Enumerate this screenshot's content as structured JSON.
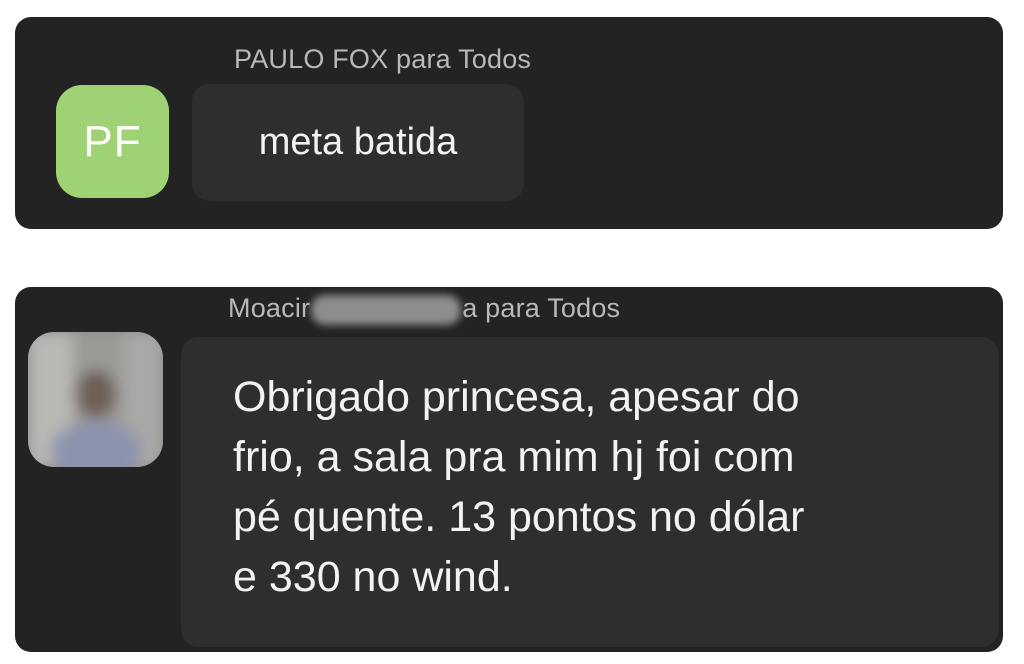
{
  "messages": [
    {
      "sender": "PAULO FOX para Todos",
      "avatar_initials": "PF",
      "avatar_color": "#9fd274",
      "text": "meta batida"
    },
    {
      "sender_first": "Moacir",
      "sender_rest": "a para Todos",
      "avatar_icon": "blurred-user-photo",
      "text_lines": [
        "Obrigado princesa, apesar do",
        "frio, a sala pra mim hj foi com",
        "pé  quente. 13 pontos no dólar",
        "e 330 no wind."
      ]
    }
  ],
  "colors": {
    "panel": "#232323",
    "bubble": "#2e2e2e",
    "sender_text": "#b9b9b9",
    "message_text": "#f2f2f2"
  }
}
